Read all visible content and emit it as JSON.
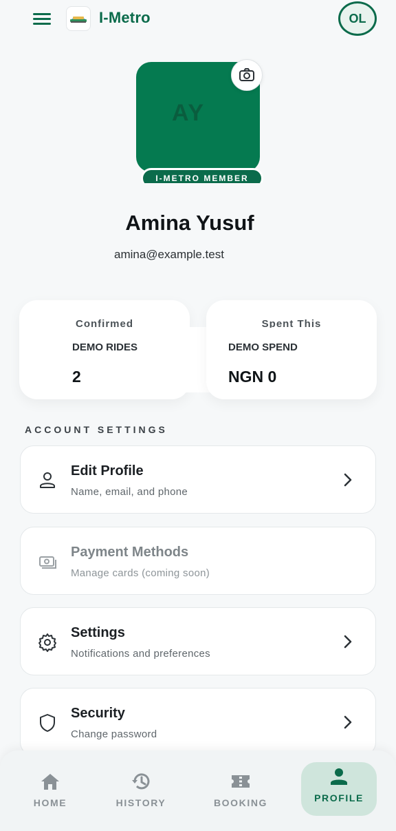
{
  "header": {
    "title": "I-Metro",
    "menu_icon": "hamburger-menu-icon",
    "logo_icon": "i-metro-logo",
    "user_initials": "OL"
  },
  "profile": {
    "initials": "AY",
    "badge": "I-METRO MEMBER",
    "name": "Amina Yusuf",
    "email": "amina@example.test",
    "camera_icon": "camera-icon"
  },
  "stats": [
    {
      "faded_label": "Confirmed",
      "label": "DEMO RIDES",
      "value": "2"
    },
    {
      "faded_label": "Spent This",
      "label": "DEMO SPEND",
      "value": "NGN 0"
    }
  ],
  "account_settings": {
    "title": "ACCOUNT SETTINGS",
    "items": [
      {
        "title": "Edit Profile",
        "subtitle": "Name, email, and phone",
        "icon": "person-icon",
        "enabled": true
      },
      {
        "title": "Payment Methods",
        "subtitle": "Manage cards (coming soon)",
        "icon": "payment-card-icon",
        "enabled": false
      },
      {
        "title": "Settings",
        "subtitle": "Notifications and preferences",
        "icon": "gear-icon",
        "enabled": true
      },
      {
        "title": "Security",
        "subtitle": "Change password",
        "icon": "shield-icon",
        "enabled": true
      }
    ]
  },
  "bottom_nav": {
    "items": [
      {
        "label": "HOME",
        "icon": "home-icon"
      },
      {
        "label": "HISTORY",
        "icon": "history-icon"
      },
      {
        "label": "BOOKING",
        "icon": "ticket-icon"
      },
      {
        "label": "PROFILE",
        "icon": "person-icon",
        "active": true
      }
    ]
  },
  "colors": {
    "brand": "#0b6b4b",
    "avatar_bg": "#057a50",
    "background": "#f6f8f9",
    "active_nav_bg": "#cfe5dc"
  }
}
